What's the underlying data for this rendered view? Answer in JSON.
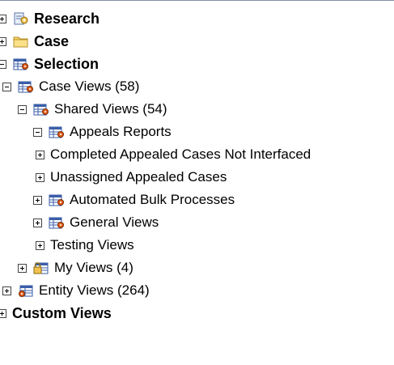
{
  "tree": {
    "research": {
      "label": "Research"
    },
    "case": {
      "label": "Case"
    },
    "selection": {
      "label": "Selection"
    },
    "case_views": {
      "label": "Case Views (58)"
    },
    "shared_views": {
      "label": "Shared Views (54)"
    },
    "appeals_reports": {
      "label": "Appeals Reports"
    },
    "completed_appealed": {
      "label": "Completed Appealed Cases Not Interfaced"
    },
    "unassigned_appealed": {
      "label": "Unassigned Appealed Cases"
    },
    "automated_bulk": {
      "label": "Automated Bulk Processes"
    },
    "general_views": {
      "label": "General Views"
    },
    "testing_views": {
      "label": "Testing Views"
    },
    "my_views": {
      "label": "My Views (4)"
    },
    "entity_views": {
      "label": "Entity Views (264)"
    },
    "custom_views": {
      "label": "Custom Views"
    }
  },
  "icons": {
    "research": "research-tools-icon",
    "case": "folder-icon",
    "view": "view-grid-icon",
    "locked_view": "locked-view-icon",
    "entity": "entity-view-icon"
  }
}
